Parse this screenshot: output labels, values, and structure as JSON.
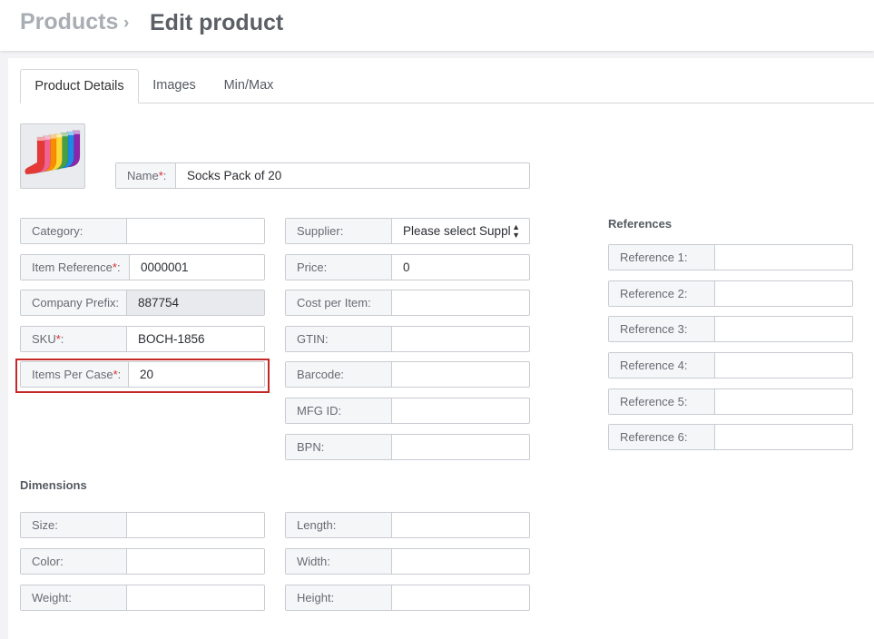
{
  "header": {
    "breadcrumb_parent": "Products",
    "breadcrumb_separator": "›",
    "title": "Edit product"
  },
  "tabs": [
    {
      "label": "Product Details",
      "active": true
    },
    {
      "label": "Images",
      "active": false
    },
    {
      "label": "Min/Max",
      "active": false
    }
  ],
  "product_image": {
    "icon": "rainbow-socks-image"
  },
  "name_field": {
    "label": "Name",
    "required": true,
    "value": "Socks Pack of 20"
  },
  "left_fields": [
    {
      "label": "Category:",
      "value": "",
      "required": false
    },
    {
      "label": "Item Reference",
      "value": "0000001",
      "required": true
    },
    {
      "label": "Company Prefix:",
      "value": "887754",
      "required": false,
      "readonly": true
    },
    {
      "label": "SKU",
      "value": "BOCH-1856",
      "required": true
    },
    {
      "label": "Items Per Case",
      "value": "20",
      "required": true,
      "highlighted": true
    }
  ],
  "middle_fields": [
    {
      "label": "Supplier:",
      "value": "Please select Supplier",
      "type": "select"
    },
    {
      "label": "Price:",
      "value": "0"
    },
    {
      "label": "Cost per Item:",
      "value": ""
    },
    {
      "label": "GTIN:",
      "value": ""
    },
    {
      "label": "Barcode:",
      "value": ""
    },
    {
      "label": "MFG ID:",
      "value": ""
    },
    {
      "label": "BPN:",
      "value": ""
    }
  ],
  "references": {
    "title": "References",
    "fields": [
      {
        "label": "Reference 1:",
        "value": ""
      },
      {
        "label": "Reference 2:",
        "value": ""
      },
      {
        "label": "Reference 3:",
        "value": ""
      },
      {
        "label": "Reference 4:",
        "value": ""
      },
      {
        "label": "Reference 5:",
        "value": ""
      },
      {
        "label": "Reference 6:",
        "value": ""
      }
    ]
  },
  "dimensions": {
    "title": "Dimensions",
    "left": [
      {
        "label": "Size:",
        "value": ""
      },
      {
        "label": "Color:",
        "value": ""
      },
      {
        "label": "Weight:",
        "value": ""
      }
    ],
    "right": [
      {
        "label": "Length:",
        "value": ""
      },
      {
        "label": "Width:",
        "value": ""
      },
      {
        "label": "Height:",
        "value": ""
      }
    ]
  },
  "colors": {
    "required_marker": "#d32f2f",
    "highlight_border": "#c62828",
    "sock_colors": [
      "#e53935",
      "#f06292",
      "#fb8c00",
      "#fdd835",
      "#43a047",
      "#1e88e5",
      "#8e24aa"
    ]
  }
}
